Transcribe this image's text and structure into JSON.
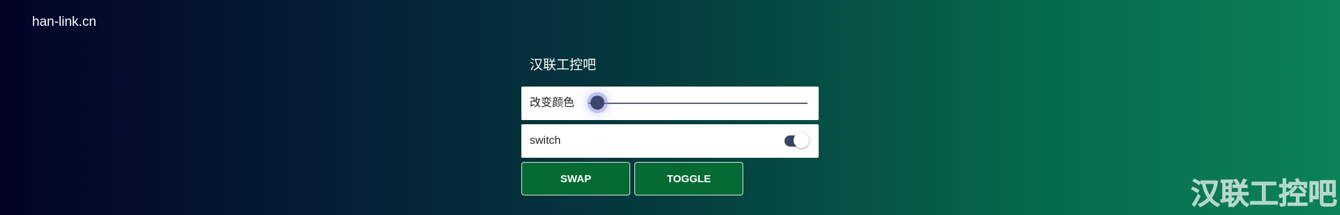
{
  "header": {
    "site_name": "han-link.cn"
  },
  "panel": {
    "title": "汉联工控吧",
    "color_control": {
      "label": "改变颜色",
      "slider_value": 0.05
    },
    "switch_control": {
      "label": "switch",
      "state": "on"
    },
    "buttons": {
      "swap_label": "SWAP",
      "toggle_label": "TOGGLE"
    }
  },
  "watermark": {
    "text": "汉联工控吧"
  },
  "colors": {
    "background_start": "#020326",
    "background_end": "#0b8258",
    "button": "#066a33",
    "slider_thumb": "#3d466e",
    "switch_track": "#3a4463"
  }
}
